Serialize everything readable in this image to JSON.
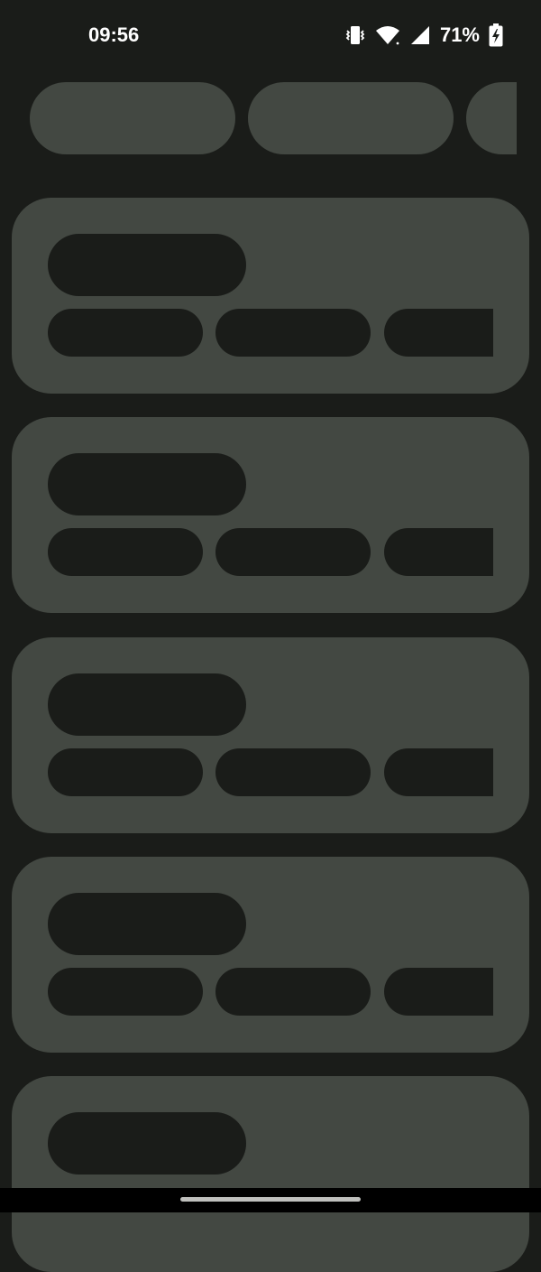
{
  "status_bar": {
    "time": "09:56",
    "battery_percent": "71%",
    "icons": [
      "vibrate-icon",
      "wifi-icon",
      "signal-icon",
      "battery-charging-icon"
    ]
  },
  "colors": {
    "background": "#1a1c19",
    "placeholder_surface": "#434842",
    "placeholder_inner": "#1a1c19",
    "text": "#ffffff"
  },
  "loading_state": {
    "filter_chips": 3,
    "cards": 5
  }
}
